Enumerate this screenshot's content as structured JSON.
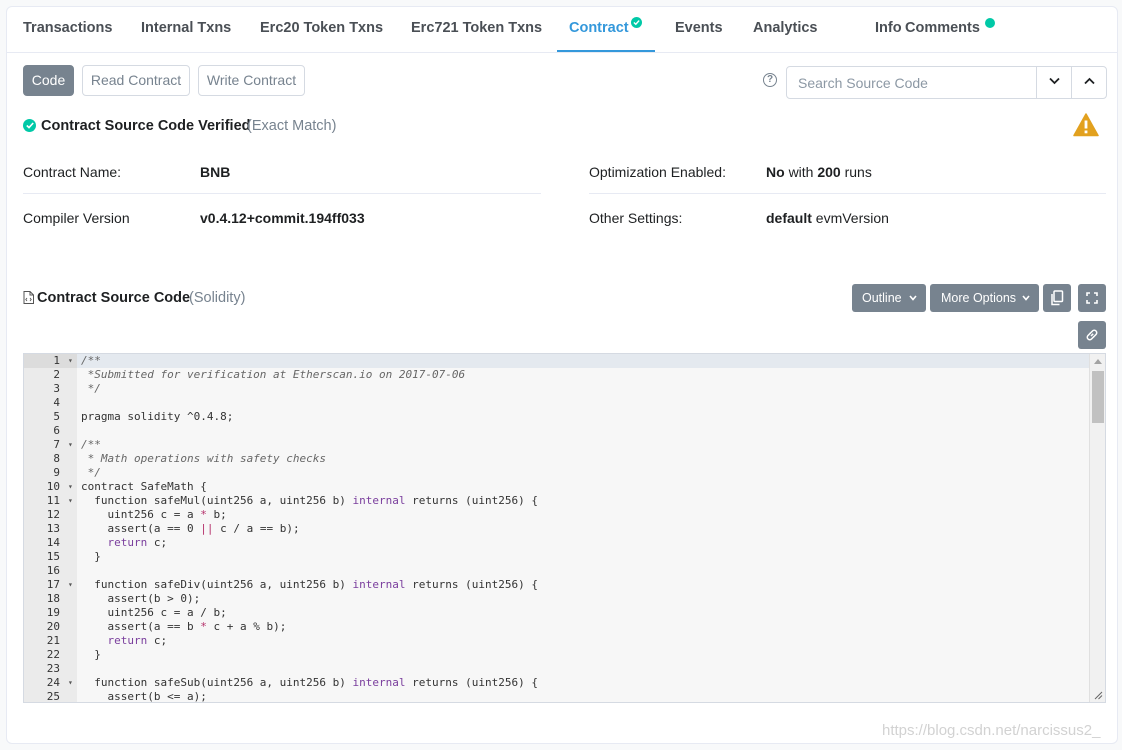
{
  "tabs": [
    {
      "label": "Transactions"
    },
    {
      "label": "Internal Txns"
    },
    {
      "label": "Erc20 Token Txns"
    },
    {
      "label": "Erc721 Token Txns"
    },
    {
      "label": "Contract"
    },
    {
      "label": "Events"
    },
    {
      "label": "Analytics"
    },
    {
      "label": "Info"
    },
    {
      "label": "Comments"
    }
  ],
  "active_tab": "Contract",
  "accent_color": "#3498db",
  "badge_color": "#00c9a7",
  "subnav": {
    "code": "Code",
    "read": "Read Contract",
    "write": "Write Contract"
  },
  "search": {
    "placeholder": "Search Source Code",
    "help": "?"
  },
  "verified": {
    "title": "Contract Source Code Verified",
    "subtitle": "(Exact Match)"
  },
  "info": {
    "contract_name_label": "Contract Name:",
    "contract_name_value": "BNB",
    "compiler_label": "Compiler Version",
    "compiler_value": "v0.4.12+commit.194ff033",
    "optimization_label": "Optimization Enabled:",
    "optimization_no": "No",
    "optimization_with": "with",
    "optimization_runs_num": "200",
    "optimization_runs": "runs",
    "other_label": "Other Settings:",
    "other_default": "default",
    "other_evm": "evmVersion"
  },
  "source": {
    "title": "Contract Source Code",
    "lang": "(Solidity)",
    "outline_label": "Outline",
    "more_label": "More Options"
  },
  "code_lines": [
    {
      "n": "1",
      "fold": true,
      "t": [
        [
          "c",
          "/**"
        ]
      ]
    },
    {
      "n": "2",
      "t": [
        [
          "c",
          " *Submitted for verification at Etherscan.io on 2017-07-06"
        ]
      ]
    },
    {
      "n": "3",
      "t": [
        [
          "c",
          " */"
        ]
      ]
    },
    {
      "n": "4",
      "t": []
    },
    {
      "n": "5",
      "t": [
        [
          "p",
          "pragma solidity ^0.4.8;"
        ]
      ]
    },
    {
      "n": "6",
      "t": []
    },
    {
      "n": "7",
      "fold": true,
      "t": [
        [
          "c",
          "/**"
        ]
      ]
    },
    {
      "n": "8",
      "t": [
        [
          "c",
          " * Math operations with safety checks"
        ]
      ]
    },
    {
      "n": "9",
      "t": [
        [
          "c",
          " */"
        ]
      ]
    },
    {
      "n": "10",
      "fold": true,
      "t": [
        [
          "p",
          "contract SafeMath {"
        ]
      ]
    },
    {
      "n": "11",
      "fold": true,
      "t": [
        [
          "p",
          "  function safeMul(uint256 a, uint256 b) "
        ],
        [
          "k",
          "internal"
        ],
        [
          "p",
          " returns (uint256) {"
        ]
      ]
    },
    {
      "n": "12",
      "t": [
        [
          "p",
          "    uint256 c = a "
        ],
        [
          "o",
          "*"
        ],
        [
          "p",
          " b;"
        ]
      ]
    },
    {
      "n": "13",
      "t": [
        [
          "p",
          "    assert(a == 0 "
        ],
        [
          "o",
          "||"
        ],
        [
          "p",
          " c / a == b);"
        ]
      ]
    },
    {
      "n": "14",
      "t": [
        [
          "p",
          "    "
        ],
        [
          "k",
          "return"
        ],
        [
          "p",
          " c;"
        ]
      ]
    },
    {
      "n": "15",
      "t": [
        [
          "p",
          "  }"
        ]
      ]
    },
    {
      "n": "16",
      "t": []
    },
    {
      "n": "17",
      "fold": true,
      "t": [
        [
          "p",
          "  function safeDiv(uint256 a, uint256 b) "
        ],
        [
          "k",
          "internal"
        ],
        [
          "p",
          " returns (uint256) {"
        ]
      ]
    },
    {
      "n": "18",
      "t": [
        [
          "p",
          "    assert(b > 0);"
        ]
      ]
    },
    {
      "n": "19",
      "t": [
        [
          "p",
          "    uint256 c = a / b;"
        ]
      ]
    },
    {
      "n": "20",
      "t": [
        [
          "p",
          "    assert(a == b "
        ],
        [
          "o",
          "*"
        ],
        [
          "p",
          " c + a % b);"
        ]
      ]
    },
    {
      "n": "21",
      "t": [
        [
          "p",
          "    "
        ],
        [
          "k",
          "return"
        ],
        [
          "p",
          " c;"
        ]
      ]
    },
    {
      "n": "22",
      "t": [
        [
          "p",
          "  }"
        ]
      ]
    },
    {
      "n": "23",
      "t": []
    },
    {
      "n": "24",
      "fold": true,
      "t": [
        [
          "p",
          "  function safeSub(uint256 a, uint256 b) "
        ],
        [
          "k",
          "internal"
        ],
        [
          "p",
          " returns (uint256) {"
        ]
      ]
    },
    {
      "n": "25",
      "t": [
        [
          "p",
          "    assert(b <= a);"
        ]
      ]
    }
  ],
  "watermark": "https://blog.csdn.net/narcissus2_"
}
